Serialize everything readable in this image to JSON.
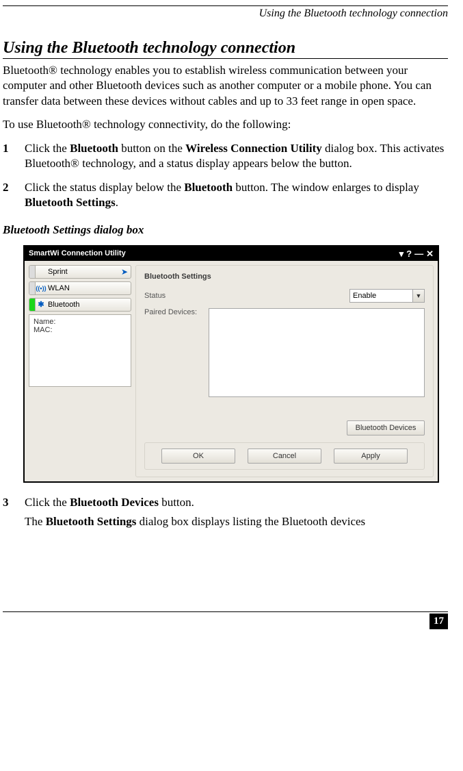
{
  "running_head": "Using the Bluetooth technology connection",
  "section_title": "Using the Bluetooth technology connection",
  "intro_paragraph": "Bluetooth® technology enables you to establish wireless communication between your computer and other Bluetooth devices such as another computer or a mobile phone. You can transfer data between these devices without cables and up to 33 feet range in open space.",
  "lead_in": "To use Bluetooth® technology connectivity, do the following:",
  "steps": {
    "s1_num": "1",
    "s1_pre": "Click the ",
    "s1_b1": "Bluetooth",
    "s1_mid": " button on the ",
    "s1_b2": "Wireless Connection Utility",
    "s1_post": " dialog box. This activates Bluetooth® technology, and a status display appears below the button.",
    "s2_num": "2",
    "s2_pre": "Click the status display below the ",
    "s2_b1": "Bluetooth",
    "s2_mid": " button. The window enlarges to display ",
    "s2_b2": "Bluetooth Settings",
    "s2_post": ".",
    "s3_num": "3",
    "s3_pre": "Click the ",
    "s3_b1": "Bluetooth Devices",
    "s3_post": " button.",
    "s3_follow_pre": "The ",
    "s3_follow_b": "Bluetooth Settings",
    "s3_follow_post": " dialog box displays listing the Bluetooth devices"
  },
  "figure_caption": "Bluetooth Settings dialog box",
  "dialog": {
    "title": "SmartWi Connection Utility",
    "left": {
      "sprint_label": "Sprint",
      "wlan_label": "WLAN",
      "wlan_icon": "((•))",
      "bt_icon": "✱",
      "bt_label": "Bluetooth",
      "info_name_label": "Name:",
      "info_mac_label": "MAC:"
    },
    "panel": {
      "title": "Bluetooth Settings",
      "status_label": "Status",
      "status_value": "Enable",
      "paired_label": "Paired Devices:",
      "devices_button": "Bluetooth Devices",
      "ok": "OK",
      "cancel": "Cancel",
      "apply": "Apply"
    }
  },
  "page_number": "17"
}
